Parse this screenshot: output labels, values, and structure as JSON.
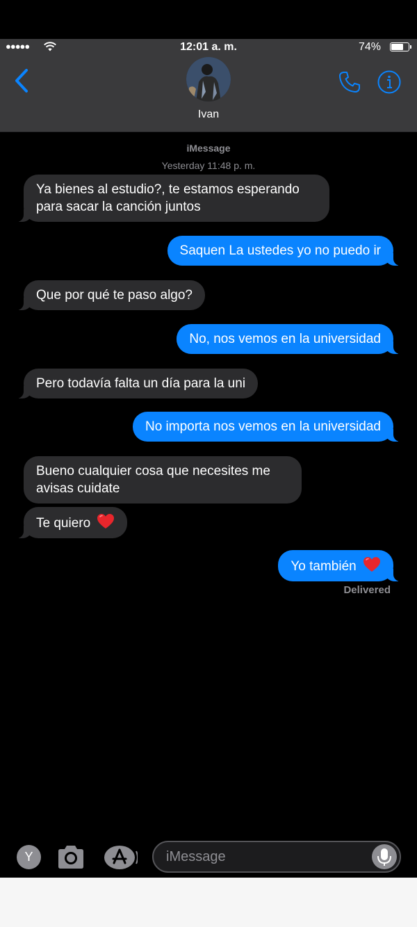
{
  "status_bar": {
    "signal": "●●●●●",
    "time": "12:01 a. m.",
    "battery": "74%",
    "battery_level": 0.74
  },
  "nav": {
    "contact_name": "Ivan",
    "icons": [
      "back-chevron-icon",
      "phone-icon",
      "info-icon"
    ],
    "accent_color": "#0a84ff"
  },
  "thread": {
    "service": "iMessage",
    "timestamp": "Yesterday 11:48 p. m.",
    "messages": [
      {
        "dir": "in",
        "text": "Ya bienes al estudio?, te estamos esperando para sacar la canción juntos"
      },
      {
        "dir": "out",
        "text": "Saquen La ustedes yo no puedo ir"
      },
      {
        "dir": "in",
        "text": "Que por qué te paso algo?"
      },
      {
        "dir": "out",
        "text": "No, nos vemos en la universidad"
      },
      {
        "dir": "in",
        "text": "Pero todavía falta un día para la uni"
      },
      {
        "dir": "out",
        "text": "No importa nos vemos en la universidad"
      },
      {
        "dir": "in",
        "text": "Bueno cualquier cosa que necesites me avisas cuidate"
      },
      {
        "dir": "in",
        "text": "Te quiero",
        "emoji": "heart-emoji"
      },
      {
        "dir": "out",
        "text": "Yo también",
        "emoji": "heart-emoji"
      }
    ],
    "delivered": "Delivered"
  },
  "toolbar": {
    "y_label": "Y",
    "input_placeholder": "iMessage",
    "icons": [
      "camera-icon",
      "app-store-icon",
      "microphone-icon"
    ]
  },
  "colors": {
    "incoming_bubble": "#2c2c2e",
    "outgoing_bubble": "#0a84ff",
    "bar_background": "#3a3a3c"
  }
}
